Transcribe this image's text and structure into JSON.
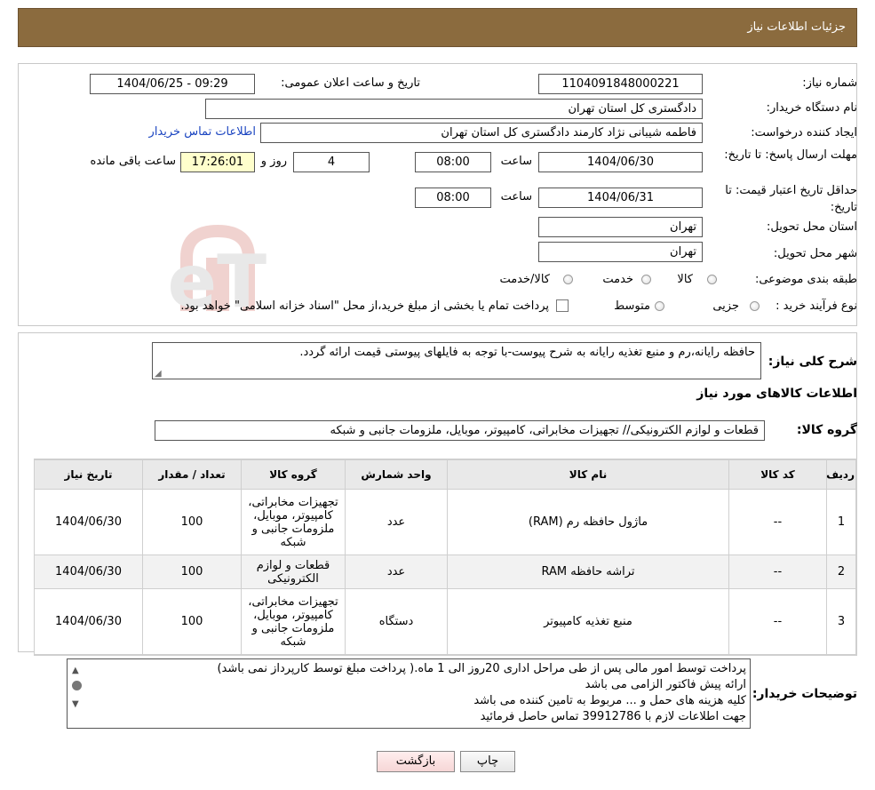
{
  "header": {
    "title": "جزئیات اطلاعات نیاز"
  },
  "form": {
    "need_number_label": "شماره نیاز:",
    "need_number": "1104091848000221",
    "announce_label": "تاریخ و ساعت اعلان عمومی:",
    "announce_value": "1404/06/25 - 09:29",
    "buyer_org_label": "نام دستگاه خریدار:",
    "buyer_org": "دادگستری کل استان تهران",
    "creator_label": "ایجاد کننده درخواست:",
    "creator": "فاطمه شیبانی نژاد کارمند دادگستری کل استان تهران",
    "contact_link": "اطلاعات تماس خریدار",
    "deadline_label": "مهلت ارسال پاسخ: تا تاریخ:",
    "deadline_date": "1404/06/30",
    "time_label": "ساعت",
    "deadline_time": "08:00",
    "days_value": "4",
    "days_label": "روز و",
    "remaining_time": "17:26:01",
    "remaining_label": "ساعت باقی مانده",
    "validity_label": "حداقل تاریخ اعتبار قیمت: تا تاریخ:",
    "validity_date": "1404/06/31",
    "validity_time": "08:00",
    "province_label": "استان محل تحویل:",
    "province": "تهران",
    "city_label": "شهر محل تحویل:",
    "city": "تهران",
    "category_label": "طبقه بندی موضوعی:",
    "category_options": [
      "کالا",
      "خدمت",
      "کالا/خدمت"
    ],
    "process_label": "نوع فرآیند خرید :",
    "process_options": [
      "جزیی",
      "متوسط"
    ],
    "process_note": "پرداخت تمام یا بخشی از مبلغ خرید،از محل \"اسناد خزانه اسلامی\" خواهد بود."
  },
  "description": {
    "label": "شرح کلی نیاز:",
    "text": "حافظه رایانه،رم و منبع تغذیه رایانه به شرح پیوست-با توجه به فایلهای پیوستی قیمت ارائه گردد.",
    "goods_info_title": "اطلاعات کالاهای مورد نیاز",
    "goods_group_label": "گروه کالا:",
    "goods_group": "قطعات و لوازم الکترونیکی// تجهیزات مخابراتی، کامپیوتر، موبایل، ملزومات جانبی و شبکه"
  },
  "table": {
    "headers": [
      "ردیف",
      "کد کالا",
      "نام کالا",
      "واحد شمارش",
      "گروه کالا",
      "تعداد / مقدار",
      "تاریخ نیاز"
    ],
    "rows": [
      [
        "1",
        "--",
        "ماژول حافظه رم (RAM)",
        "عدد",
        "تجهیزات مخابراتی، کامپیوتر، موبایل، ملزومات جانبی و شبکه",
        "100",
        "1404/06/30"
      ],
      [
        "2",
        "--",
        "تراشه حافظه RAM",
        "عدد",
        "قطعات و لوازم الکترونیکی",
        "100",
        "1404/06/30"
      ],
      [
        "3",
        "--",
        "منبع تغذیه کامپیوتر",
        "دستگاه",
        "تجهیزات مخابراتی، کامپیوتر، موبایل، ملزومات جانبی و شبکه",
        "100",
        "1404/06/30"
      ]
    ]
  },
  "buyer_notes": {
    "label": "توضیحات خریدار:",
    "lines": [
      "پرداخت توسط امور مالی پس از طی مراحل اداری 20روز الی 1 ماه.( پرداخت مبلغ توسط کارپرداز نمی باشد)",
      "ارائه پیش فاکتور الزامی می باشد",
      "کلیه هزینه های حمل و ... مربوط به تامین کننده می باشد",
      "جهت اطلاعات لازم با  39912786  تماس حاصل فرمائید"
    ]
  },
  "buttons": {
    "print": "چاپ",
    "back": "بازگشت"
  },
  "watermark": {
    "text": "AriaTender.neT"
  },
  "colors": {
    "header_bg": "#8b6b3e",
    "link": "#1a44c0",
    "remaining_bg": "#ffffcc",
    "back_button": "#f6d6d6"
  }
}
